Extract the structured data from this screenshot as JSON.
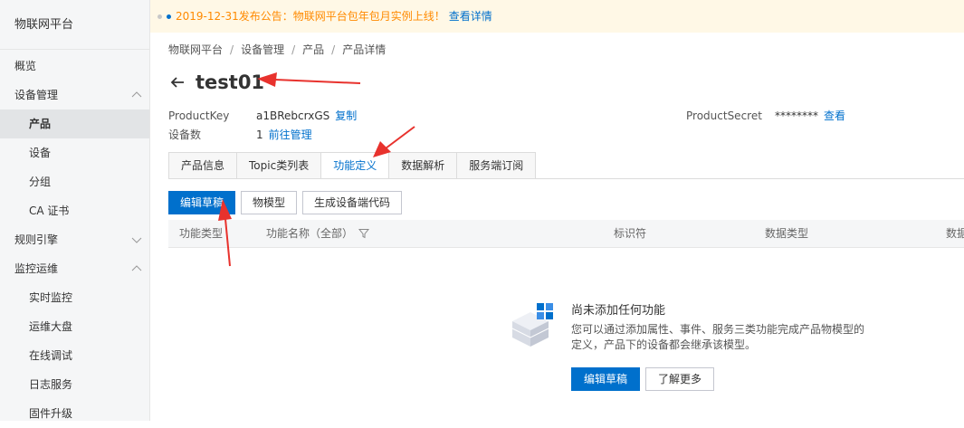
{
  "sidebar": {
    "brand": "物联网平台",
    "items": [
      {
        "label": "概览",
        "level": 1
      },
      {
        "label": "设备管理",
        "level": 1,
        "expanded": true
      },
      {
        "label": "产品",
        "level": 2,
        "active": true
      },
      {
        "label": "设备",
        "level": 2
      },
      {
        "label": "分组",
        "level": 2
      },
      {
        "label": "CA 证书",
        "level": 2
      },
      {
        "label": "规则引擎",
        "level": 1,
        "expanded": false
      },
      {
        "label": "监控运维",
        "level": 1,
        "expanded": true
      },
      {
        "label": "实时监控",
        "level": 2
      },
      {
        "label": "运维大盘",
        "level": 2
      },
      {
        "label": "在线调试",
        "level": 2
      },
      {
        "label": "日志服务",
        "level": 2
      },
      {
        "label": "固件升级",
        "level": 2
      }
    ]
  },
  "notice": {
    "text": "2019-12-31发布公告：物联网平台包年包月实例上线！",
    "link": "查看详情"
  },
  "breadcrumb": {
    "items": [
      "物联网平台",
      "设备管理",
      "产品",
      "产品详情"
    ],
    "separator": "/"
  },
  "product": {
    "title": "test01",
    "key_label": "ProductKey",
    "key_value": "a1BRebcrxGS",
    "key_action": "复制",
    "device_count_label": "设备数",
    "device_count": "1",
    "device_count_action": "前往管理",
    "secret_label": "ProductSecret",
    "secret_value": "********",
    "secret_action": "查看"
  },
  "tabs": [
    {
      "label": "产品信息"
    },
    {
      "label": "Topic类列表"
    },
    {
      "label": "功能定义",
      "active": true
    },
    {
      "label": "数据解析"
    },
    {
      "label": "服务端订阅"
    }
  ],
  "toolbar": {
    "edit_draft": "编辑草稿",
    "thing_model": "物模型",
    "generate_code": "生成设备端代码"
  },
  "table": {
    "columns": [
      "功能类型",
      "功能名称（全部）",
      "标识符",
      "数据类型",
      "数据"
    ]
  },
  "empty": {
    "title": "尚未添加任何功能",
    "desc": "您可以通过添加属性、事件、服务三类功能完成产品物模型的定义，产品下的设备都会继承该模型。",
    "edit_draft": "编辑草稿",
    "learn_more": "了解更多"
  },
  "colors": {
    "primary": "#0070cc",
    "notice_bg": "#fff8e6",
    "notice_text": "#ff8a00",
    "annotation_arrow": "#e8322d"
  }
}
